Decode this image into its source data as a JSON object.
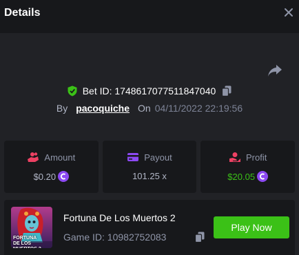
{
  "header": {
    "title": "Details"
  },
  "bet": {
    "id_label": "Bet ID: 1748617077511847040",
    "by_label": "By",
    "username": "pacoquiche",
    "on_label": "On",
    "date": "04/11/2022 22:19:56"
  },
  "stats": {
    "amount": {
      "label": "Amount",
      "value": "$0.20"
    },
    "payout": {
      "label": "Payout",
      "value": "101.25 x"
    },
    "profit": {
      "label": "Profit",
      "value": "$20.05"
    }
  },
  "game": {
    "name": "Fortuna De Los Muertos 2",
    "id_label": "Game ID: 10982752083",
    "thumb_line1": "FORTUNA",
    "thumb_line2": "DE LOS MUERTOS 2",
    "play_label": "Play Now"
  },
  "colors": {
    "accent_green": "#3bc117",
    "coin_purple": "#8c49f2",
    "bg_panel": "#212226",
    "bg_card": "#17181b"
  },
  "icons": [
    "close-icon",
    "share-icon",
    "shield-check-icon",
    "copy-icon",
    "coins-icon",
    "card-icon",
    "profit-icon",
    "coin-icon"
  ]
}
